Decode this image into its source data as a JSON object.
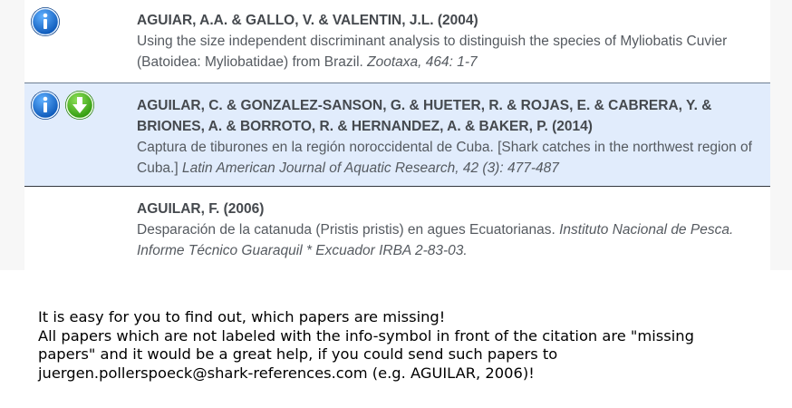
{
  "entries": [
    {
      "authors": "AGUIAR, A.A. & GALLO, V. & VALENTIN, J.L. (2004)",
      "title": "Using the size independent discriminant analysis to distinguish the species of Myliobatis Cuvier (Batoidea: Myliobatidae) from Brazil. ",
      "journal": "Zootaxa, 464: 1-7",
      "icons": [
        "info-icon"
      ]
    },
    {
      "authors": "AGUILAR, C. & GONZALEZ-SANSON, G. & HUETER, R. & ROJAS, E. & CABRERA, Y. & BRIONES, A. & BORROTO, R. & HERNANDEZ, A. & BAKER, P. (2014)",
      "title": "Captura de tiburones en la región noroccidental de Cuba. [Shark catches in the northwest region of Cuba.] ",
      "journal": "Latin American Journal of Aquatic Research, 42 (3): 477-487",
      "icons": [
        "info-icon",
        "download-icon"
      ],
      "highlighted": true
    },
    {
      "authors": "AGUILAR, F. (2006)",
      "title": "Desparación de la catanuda (Pristis pristis) en agues Ecuatorianas. ",
      "journal": "Instituto Nacional de Pesca. Informe Técnico Guaraquil * Excuador IRBA 2-83-03.",
      "icons": []
    }
  ],
  "note": {
    "line1": "It is easy for you to find out, which papers are missing!",
    "line2": "All papers which are not labeled with the info-symbol in front of the citation are \"missing",
    "line3": "papers\" and it would be a great help, if you could send such papers to",
    "line4": "juergen.pollerspoeck@shark-references.com (e.g. AGUILAR, 2006)!"
  },
  "colors": {
    "highlight": "#e1ecfc",
    "info_icon": "#1a6fd1",
    "download_icon": "#4cb81f",
    "text": "#555a60"
  }
}
